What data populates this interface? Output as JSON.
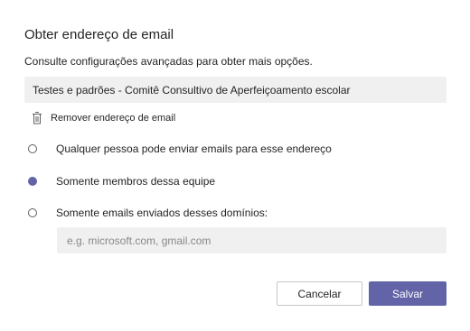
{
  "dialog": {
    "title": "Obter endereço de email",
    "subtitle": "Consulte configurações avançadas para obter mais opções.",
    "email_address": "Testes e padrões - Comitê Consultivo de Aperfeiçoamento escolar",
    "remove_label": "Remover endereço de email",
    "options": [
      {
        "label": "Qualquer pessoa pode enviar emails para esse endereço",
        "selected": false
      },
      {
        "label": "Somente membros dessa equipe",
        "selected": true
      },
      {
        "label": "Somente emails enviados desses domínios:",
        "selected": false
      }
    ],
    "domains_placeholder": "e.g. microsoft.com, gmail.com",
    "domains_value": "",
    "cancel_label": "Cancelar",
    "save_label": "Salvar"
  },
  "colors": {
    "accent": "#6264a7",
    "field_background": "#f0f0f0",
    "text": "#252424"
  },
  "icons": {
    "remove": "trash-icon"
  }
}
